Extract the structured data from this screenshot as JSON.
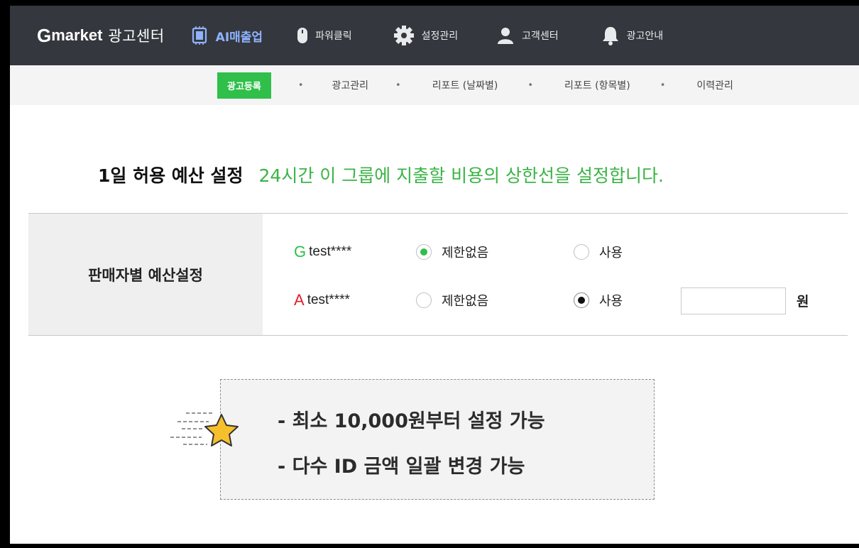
{
  "nav": {
    "logo_g": "G",
    "logo_market": "market",
    "logo_center": "광고센터",
    "items": [
      {
        "label": "AI매출업",
        "icon": "chip-icon"
      },
      {
        "label": "파워클릭",
        "icon": "mouse-icon"
      },
      {
        "label": "설정관리",
        "icon": "gear-icon"
      },
      {
        "label": "고객센터",
        "icon": "person-icon"
      },
      {
        "label": "광고안내",
        "icon": "bell-icon"
      }
    ]
  },
  "subnav": {
    "items": [
      "광고등록",
      "광고관리",
      "리포트 (날짜별)",
      "리포트 (항목별)",
      "이력관리"
    ],
    "separator": "•",
    "active": "광고등록"
  },
  "heading": {
    "title": "1일 허용 예산 설정",
    "description": "24시간 이 그룹에 지출할 비용의 상한선을 설정합니다."
  },
  "budget": {
    "label": "판매자별 예산설정",
    "accounts": [
      {
        "letter": "G",
        "letter_color": "#2fbf4a",
        "name": "test****",
        "selected": "unlimited"
      },
      {
        "letter": "A",
        "letter_color": "#e0202a",
        "name": "test****",
        "selected": "use",
        "amount": ""
      }
    ],
    "option_unlimited": "제한없음",
    "option_use": "사용",
    "unit": "원"
  },
  "info": {
    "line1": "- 최소 10,000원부터 설정 가능",
    "line2": "- 다수 ID 금액 일괄 변경 가능",
    "icon": "star-icon"
  },
  "colors": {
    "accent_green": "#2fbf4a",
    "description_green": "#3bb345",
    "nav_bg": "#34373d",
    "ai_blue": "#8fb3ff",
    "auction_red": "#e0202a"
  }
}
